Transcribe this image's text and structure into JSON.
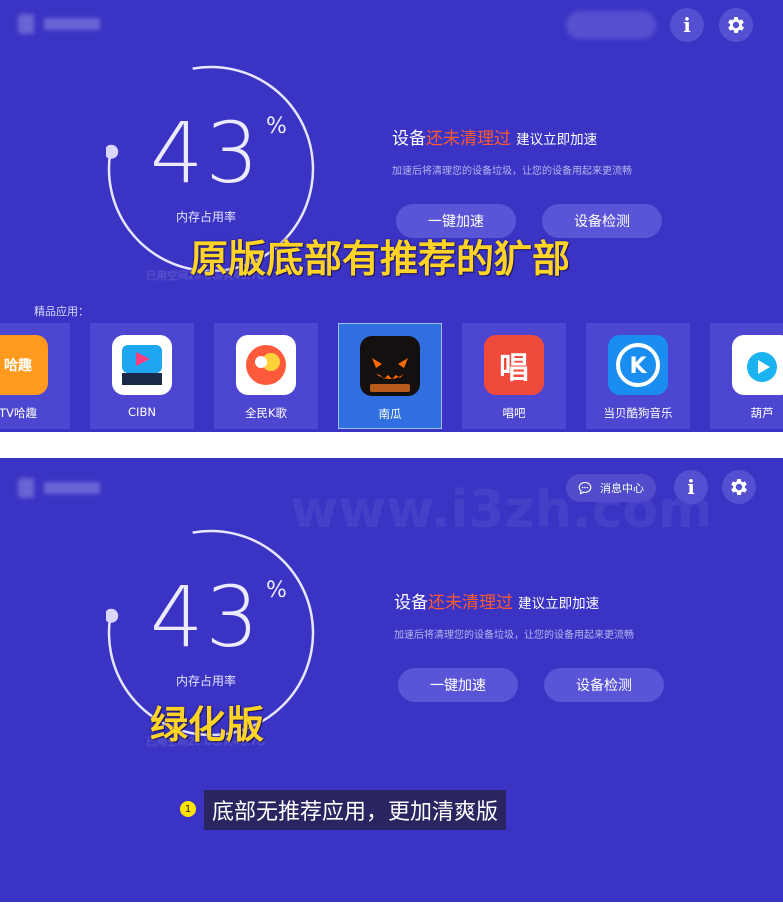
{
  "colors": {
    "background": "#3b33c4",
    "highlight": "#ff5a2e",
    "button": "#5a55d6",
    "overlay_text": "#ffd426",
    "caption_badge": "#ffe400"
  },
  "top": {
    "memory": {
      "percent": "43",
      "percent_sign": "%",
      "label": "内存占用率",
      "used_space": "已用空间20.0G/共46.7G",
      "usage_fraction": 0.43
    },
    "status": {
      "prefix": "设备",
      "highlight": "还未清理过",
      "suffix": "建议立即加速",
      "description": "加速后将清理您的设备垃圾，让您的设备用起来更流畅"
    },
    "buttons": {
      "boost": "一键加速",
      "detect": "设备检测"
    },
    "overlay_text": "原版底部有推荐的犷部",
    "featured_label": "精品应用：",
    "apps": [
      {
        "name": "TV哈趣",
        "icon": "haqu-icon"
      },
      {
        "name": "CIBN",
        "icon": "cibn-icon"
      },
      {
        "name": "全民K歌",
        "icon": "kge-icon"
      },
      {
        "name": "南瓜",
        "icon": "pumpkin-icon",
        "selected": true
      },
      {
        "name": "唱吧",
        "icon": "changba-icon"
      },
      {
        "name": "当贝酷狗音乐",
        "icon": "kugou-icon"
      },
      {
        "name": "葫芦",
        "icon": "hulu-icon"
      }
    ]
  },
  "bottom": {
    "message_center": "消息中心",
    "memory": {
      "percent": "43",
      "percent_sign": "%",
      "label": "内存占用率",
      "used_space": "已用空间20.0G/共46.7G",
      "usage_fraction": 0.43
    },
    "status": {
      "prefix": "设备",
      "highlight": "还未清理过",
      "suffix": "建议立即加速",
      "description": "加速后将清理您的设备垃圾，让您的设备用起来更流畅"
    },
    "buttons": {
      "boost": "一键加速",
      "detect": "设备检测"
    },
    "overlay_text": "绿化版",
    "watermark": "www.i3zh.com",
    "caption_number": "1",
    "caption": "底部无推荐应用，更加清爽版"
  }
}
